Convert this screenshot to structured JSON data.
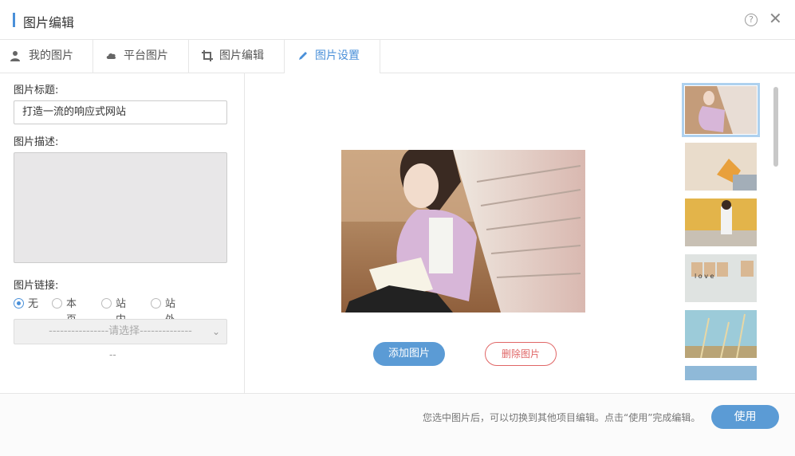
{
  "header": {
    "title": "图片编辑",
    "help_symbol": "?",
    "close_symbol": "✕"
  },
  "tabs": [
    {
      "label": "我的图片",
      "icon": "user-icon"
    },
    {
      "label": "平台图片",
      "icon": "cloud-icon"
    },
    {
      "label": "图片编辑",
      "icon": "crop-icon"
    },
    {
      "label": "图片设置",
      "icon": "pencil-icon",
      "active": true
    }
  ],
  "form": {
    "title_label": "图片标题:",
    "title_value": "打造一流的响应式网站",
    "desc_label": "图片描述:",
    "desc_value": "",
    "link_label": "图片链接:",
    "link_options": [
      "无",
      "本页",
      "站内",
      "站外"
    ],
    "link_selected": "无",
    "select_placeholder": "----------------请选择--------------",
    "dash_text": "--"
  },
  "actions": {
    "add_label": "添加图片",
    "delete_label": "删除图片"
  },
  "thumbnails": [
    {
      "name": "girl-reading-by-bookshelf",
      "selected": true
    },
    {
      "name": "autumn-leaf"
    },
    {
      "name": "girl-under-autumn-tree"
    },
    {
      "name": "love-stamps"
    },
    {
      "name": "reed-grass-sky"
    },
    {
      "name": "sky-partial"
    }
  ],
  "footer": {
    "note": "您选中图片后，可以切换到其他项目编辑。点击“使用”完成编辑。",
    "use_label": "使用"
  },
  "colors": {
    "accent": "#4a90d9",
    "button_blue": "#5b9bd5",
    "danger": "#e06666"
  }
}
